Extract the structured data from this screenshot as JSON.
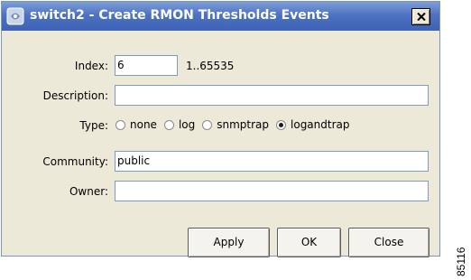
{
  "window": {
    "title": "switch2 - Create RMON Thresholds Events",
    "close_symbol": "close-x-icon"
  },
  "form": {
    "index_label": "Index:",
    "index_value": "6",
    "index_range": "1..65535",
    "description_label": "Description:",
    "description_value": "",
    "type_label": "Type:",
    "type_options": [
      "none",
      "log",
      "snmptrap",
      "logandtrap"
    ],
    "type_selected": "logandtrap",
    "community_label": "Community:",
    "community_value": "public",
    "owner_label": "Owner:",
    "owner_value": ""
  },
  "buttons": {
    "apply": "Apply",
    "ok": "OK",
    "close": "Close"
  },
  "figure_code": "85116",
  "colors": {
    "titlebar": "#4d72c1",
    "window_bg": "#ece9d8",
    "field_border": "#7f9db9"
  }
}
